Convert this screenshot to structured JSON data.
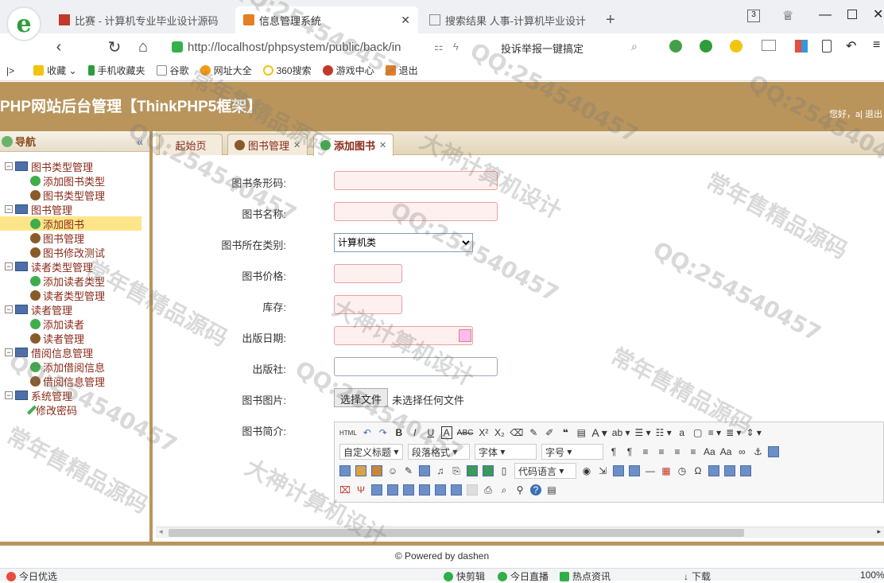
{
  "browser": {
    "tabs": [
      {
        "title": "比赛 - 计算机专业毕业设计源码"
      },
      {
        "title": "信息管理系统"
      },
      {
        "title": "搜索结果 人事-计算机毕业设计"
      }
    ],
    "tab_count": "3",
    "url": "http://localhost/phpsystem/public/back/in",
    "search_hint": "投诉举报一键搞定",
    "bookmarks": [
      "收藏",
      "手机收藏夹",
      "谷歌",
      "网址大全",
      "360搜索",
      "游戏中心",
      "退出"
    ]
  },
  "app": {
    "title": "PHP网站后台管理【ThinkPHP5框架】",
    "greeting": "您好，a| 退出"
  },
  "sidebar": {
    "heading": "导航",
    "collapse": "«",
    "groups": [
      {
        "label": "图书类型管理",
        "children": [
          "添加图书类型",
          "图书类型管理"
        ]
      },
      {
        "label": "图书管理",
        "children": [
          "添加图书",
          "图书管理",
          "图书修改测试"
        ]
      },
      {
        "label": "读者类型管理",
        "children": [
          "添加读者类型",
          "读者类型管理"
        ]
      },
      {
        "label": "读者管理",
        "children": [
          "添加读者",
          "读者管理"
        ]
      },
      {
        "label": "借阅信息管理",
        "children": [
          "添加借阅信息",
          "借阅信息管理"
        ]
      },
      {
        "label": "系统管理",
        "children": [
          "修改密码"
        ]
      }
    ]
  },
  "content_tabs": [
    {
      "label": "起始页"
    },
    {
      "label": "图书管理"
    },
    {
      "label": "添加图书"
    }
  ],
  "form": {
    "barcode_label": "图书条形码:",
    "name_label": "图书名称:",
    "category_label": "图书所在类别:",
    "category_value": "计算机类",
    "price_label": "图书价格:",
    "stock_label": "库存:",
    "pubdate_label": "出版日期:",
    "publisher_label": "出版社:",
    "image_label": "图书图片:",
    "file_button": "选择文件",
    "file_status": "未选择任何文件",
    "intro_label": "图书简介:"
  },
  "editor": {
    "dropdowns": [
      "自定义标题",
      "段落格式",
      "字体",
      "字号",
      "代码语言"
    ],
    "html_label": "HTML"
  },
  "footer": "© Powered by dashen",
  "statusbar": [
    "今日优选",
    "快剪辑",
    "今日直播",
    "热点资讯",
    "下载",
    "100%"
  ],
  "watermarks": [
    "QQ:254540457",
    "常年售精品源码",
    "大神计算机设计"
  ]
}
